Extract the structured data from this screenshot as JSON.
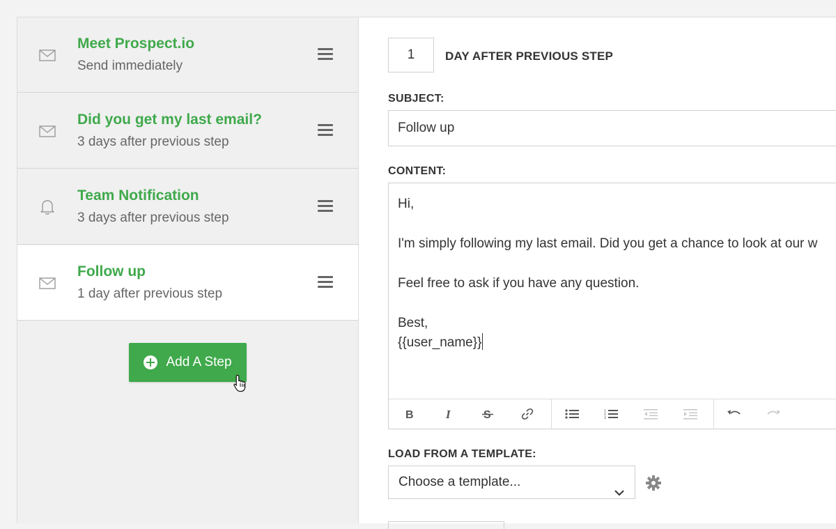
{
  "sidebar": {
    "steps": [
      {
        "title": "Meet Prospect.io",
        "subtitle": "Send immediately",
        "icon": "envelope-icon"
      },
      {
        "title": "Did you get my last email?",
        "subtitle": "3 days after previous step",
        "icon": "envelope-icon"
      },
      {
        "title": "Team Notification",
        "subtitle": "3 days after previous step",
        "icon": "bell-icon"
      },
      {
        "title": "Follow up",
        "subtitle": "1 day after previous step",
        "icon": "envelope-icon",
        "active": true
      }
    ],
    "add_step_label": "Add A Step"
  },
  "main": {
    "days_value": "1",
    "days_label": "DAY AFTER PREVIOUS STEP",
    "subject_label": "SUBJECT:",
    "subject_value": "Follow up",
    "content_label": "CONTENT:",
    "content": {
      "line1": "Hi,",
      "line2": "I'm simply following my last email. Did you get a chance to look at our w",
      "line3": "Feel free to ask if you have any question.",
      "line4": "Best,",
      "line5": "{{user_name}}"
    },
    "template_label": "LOAD FROM A TEMPLATE:",
    "template_value": "Choose a template..."
  },
  "colors": {
    "accent": "#3fa94b",
    "sidebar_bg": "#f0f0f0",
    "border": "#cfcfcf"
  }
}
